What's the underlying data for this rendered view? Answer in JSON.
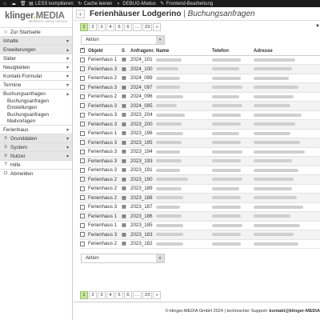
{
  "topbar": {
    "items": [
      {
        "icon": "home-icon",
        "label": ""
      },
      {
        "icon": "cloud-icon",
        "label": ""
      },
      {
        "icon": "trash-icon",
        "label": ""
      },
      {
        "icon": "file-icon",
        "label": "LESS kompilieren"
      },
      {
        "icon": "refresh-icon",
        "label": "Cache leeren"
      },
      {
        "icon": "toggle-icon",
        "label": "DEBUG-Modus"
      },
      {
        "icon": "edit-icon",
        "label": "Frontend-Bearbeitung"
      }
    ]
  },
  "sidebar": {
    "logo": {
      "brand_k": "klinger",
      "brand_dot": ".",
      "brand_m": "MEDIA",
      "tagline": "WEBSITES | MEDIA | DESIGN"
    },
    "items": [
      {
        "label": "Zur Startseite",
        "icon": "home-icon",
        "type": "link"
      },
      {
        "label": "Inhalte",
        "icon": "",
        "type": "group",
        "chev": "▾"
      },
      {
        "label": "Erweiterungen",
        "icon": "",
        "type": "group",
        "chev": "▴"
      },
      {
        "label": "Slider",
        "type": "item",
        "chev": "▾"
      },
      {
        "label": "Neuigkeiten",
        "type": "item",
        "chev": "▾"
      },
      {
        "label": "Kontakt-Formular",
        "type": "item",
        "chev": "▾"
      },
      {
        "label": "Termine",
        "type": "item",
        "chev": "▾"
      },
      {
        "label": "Buchungsanfragen",
        "type": "item",
        "chev": "▴"
      },
      {
        "label": "Ferienhaus",
        "type": "item",
        "chev": "▾"
      },
      {
        "label": "Grunddaten",
        "type": "group",
        "chev": "▾"
      },
      {
        "label": "System",
        "type": "group",
        "chev": "▾"
      },
      {
        "label": "Nutzer",
        "type": "group",
        "chev": "▾"
      },
      {
        "label": "Hilfe",
        "icon": "help-icon",
        "type": "link"
      },
      {
        "label": "Abmelden",
        "icon": "logout-icon",
        "type": "link"
      }
    ],
    "submenu": [
      "Buchungsanfragen Einstellungen",
      "Buchungsanfragen Mailvorlagen"
    ]
  },
  "main": {
    "title": "Ferienhäuser Lodgerino",
    "separator": "|",
    "subtitle": "Buchungsanfragen",
    "pager": [
      "1",
      "2",
      "3",
      "4",
      "5",
      "6",
      "...",
      "23",
      "»"
    ],
    "current_page": "1",
    "action_select": "Aktion",
    "columns": [
      "",
      "Objekt",
      "S",
      "Anfragenr.",
      "Name",
      "Telefon",
      "Adresse"
    ],
    "rows": [
      {
        "objekt": "Ferienhaus 1",
        "nr": "2024_101"
      },
      {
        "objekt": "Ferienhaus 3",
        "nr": "2024_100"
      },
      {
        "objekt": "Ferienhaus 2",
        "nr": "2024_099"
      },
      {
        "objekt": "Ferienhaus 3",
        "nr": "2024_097"
      },
      {
        "objekt": "Ferienhaus 2",
        "nr": "2024_096"
      },
      {
        "objekt": "Ferienhaus 3",
        "nr": "2024_095"
      },
      {
        "objekt": "Ferienhaus 3",
        "nr": "2023_204"
      },
      {
        "objekt": "Ferienhaus 3",
        "nr": "2023_200"
      },
      {
        "objekt": "Ferienhaus 1",
        "nr": "2023_196"
      },
      {
        "objekt": "Ferienhaus 3",
        "nr": "2023_195"
      },
      {
        "objekt": "Ferienhaus 3",
        "nr": "2023_194"
      },
      {
        "objekt": "Ferienhaus 3",
        "nr": "2023_193"
      },
      {
        "objekt": "Ferienhaus 3",
        "nr": "2023_191"
      },
      {
        "objekt": "Ferienhaus 2",
        "nr": "2023_190"
      },
      {
        "objekt": "Ferienhaus 2",
        "nr": "2023_189"
      },
      {
        "objekt": "Ferienhaus 2",
        "nr": "2023_188"
      },
      {
        "objekt": "Ferienhaus 3",
        "nr": "2023_187"
      },
      {
        "objekt": "Ferienhaus 1",
        "nr": "2023_186"
      },
      {
        "objekt": "Ferienhaus 1",
        "nr": "2023_185"
      },
      {
        "objekt": "Ferienhaus 3",
        "nr": "2023_183"
      },
      {
        "objekt": "Ferienhaus 2",
        "nr": "2023_182"
      }
    ]
  },
  "footer": {
    "copyright": "© klinger.MEDIA GmbH 2024 | technischer Support:",
    "support": "kontakt@klinger-MEDIA"
  }
}
